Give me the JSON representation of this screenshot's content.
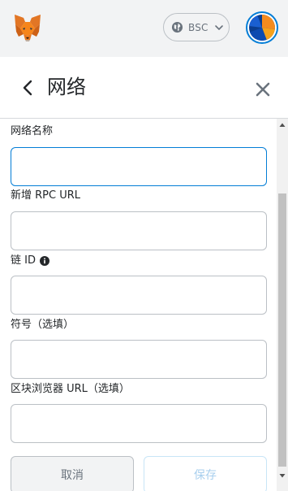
{
  "appbar": {
    "network": {
      "label": "BSC",
      "icon": "globe-icon"
    },
    "logo": "metamask-fox-icon",
    "account": "account-avatar-icon"
  },
  "header": {
    "title": "网络",
    "back_icon": "chevron-left-icon",
    "close_icon": "close-icon"
  },
  "form": {
    "fields": [
      {
        "label": "网络名称",
        "value": "",
        "placeholder": ""
      },
      {
        "label": "新增 RPC URL",
        "value": "",
        "placeholder": ""
      },
      {
        "label": "链 ID",
        "value": "",
        "placeholder": "",
        "info_icon": "info-icon"
      },
      {
        "label": "符号（选填）",
        "value": "",
        "placeholder": ""
      },
      {
        "label": "区块浏览器 URL（选填）",
        "value": "",
        "placeholder": ""
      }
    ],
    "cancel_label": "取消",
    "save_label": "保存"
  },
  "colors": {
    "accent": "#037dd6",
    "appbar_bg": "#f2f3f4",
    "border": "#bbc0c5",
    "fox_orange": "#e2761b",
    "save_disabled_text": "#a8cfee"
  }
}
